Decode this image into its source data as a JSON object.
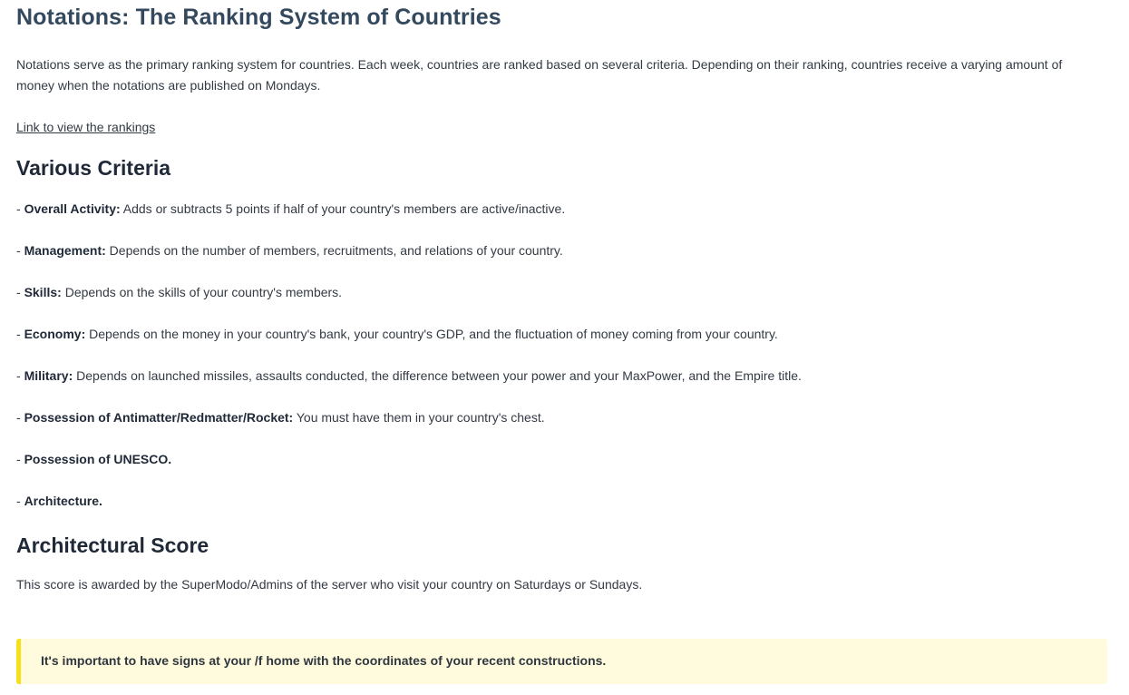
{
  "title": "Notations: The Ranking System of Countries",
  "intro": "Notations serve as the primary ranking system for countries. Each week, countries are ranked based on several criteria. Depending on their ranking, countries receive a varying amount of money when the notations are published on Mondays.",
  "rankings_link": "Link to view the rankings",
  "criteria": {
    "heading": "Various Criteria",
    "items": [
      {
        "prefix": "- ",
        "label": "Overall Activity:",
        "text": " Adds or subtracts 5 points if half of your country's members are active/inactive."
      },
      {
        "prefix": "- ",
        "label": "Management:",
        "text": " Depends on the number of members, recruitments, and relations of your country."
      },
      {
        "prefix": "- ",
        "label": "Skills:",
        "text": " Depends on the skills of your country's members."
      },
      {
        "prefix": "- ",
        "label": "Economy:",
        "text": " Depends on the money in your country's bank, your country's GDP, and the fluctuation of money coming from your country."
      },
      {
        "prefix": "- ",
        "label": "Military:",
        "text": " Depends on launched missiles, assaults conducted, the difference between your power and your MaxPower, and the Empire title."
      },
      {
        "prefix": "- ",
        "label": "Possession of Antimatter/Redmatter/Rocket:",
        "text": " You must have them in your country's chest."
      },
      {
        "prefix": "- ",
        "label": "Possession of UNESCO.",
        "text": ""
      },
      {
        "prefix": "- ",
        "label": "Architecture.",
        "text": ""
      }
    ]
  },
  "architectural": {
    "heading": "Architectural Score",
    "text": "This score is awarded by the SuperModo/Admins of the server who visit your country on Saturdays or Sundays.",
    "note": "It's important to have signs at your /f home with the coordinates of your recent constructions."
  },
  "colors": {
    "title": "#34495e",
    "note_background": "#fffbdc",
    "note_border": "#f5e118"
  }
}
